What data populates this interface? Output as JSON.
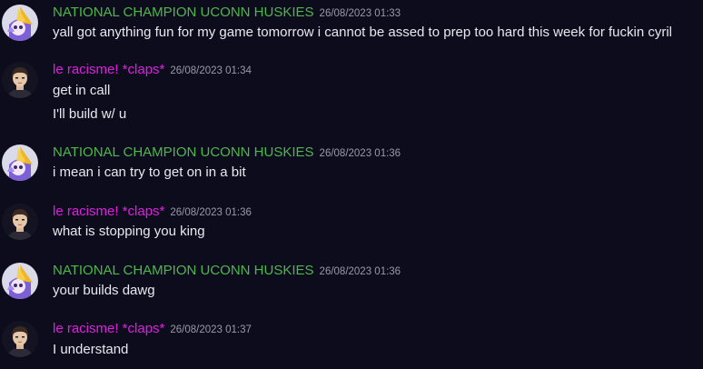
{
  "colors": {
    "background": "#0d0c1d",
    "huskies_name": "#4cb84a",
    "racisme_name": "#e01ee0",
    "timestamp": "#9a99a8",
    "text": "#e8e8ee"
  },
  "messages": [
    {
      "author": "NATIONAL CHAMPION UCONN HUSKIES",
      "avatar": "huskies-avatar",
      "timestamp": "26/08/2023 01:33",
      "lines": [
        "yall got anything fun for my game tomorrow i cannot be assed to prep too hard this week for fuckin cyril"
      ]
    },
    {
      "author": "le racisme! *claps*",
      "avatar": "racisme-avatar",
      "timestamp": "26/08/2023 01:34",
      "lines": [
        "get in call",
        "I'll build w/ u"
      ]
    },
    {
      "author": "NATIONAL CHAMPION UCONN HUSKIES",
      "avatar": "huskies-avatar",
      "timestamp": "26/08/2023 01:36",
      "lines": [
        "i mean i can try to get on in a bit"
      ]
    },
    {
      "author": "le racisme! *claps*",
      "avatar": "racisme-avatar",
      "timestamp": "26/08/2023 01:36",
      "lines": [
        "what is stopping you king"
      ]
    },
    {
      "author": "NATIONAL CHAMPION UCONN HUSKIES",
      "avatar": "huskies-avatar",
      "timestamp": "26/08/2023 01:36",
      "lines": [
        "your builds dawg"
      ]
    },
    {
      "author": "le racisme! *claps*",
      "avatar": "racisme-avatar",
      "timestamp": "26/08/2023 01:37",
      "lines": [
        "I understand"
      ]
    }
  ]
}
